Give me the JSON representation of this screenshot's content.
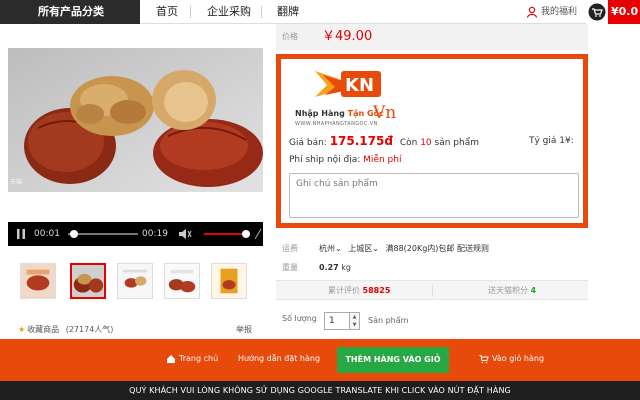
{
  "nav": {
    "category_btn": "所有产品分类",
    "items": [
      "首页",
      "企业采购",
      "翻牌"
    ],
    "favorites": "我的福利",
    "cart_price": "¥0.0"
  },
  "video": {
    "watermark": "天猫",
    "time_current": "00:01",
    "time_total": "00:19"
  },
  "left": {
    "collect": "收藏商品",
    "popularity": "(27174人气)",
    "report": "举报"
  },
  "price": {
    "label": "价格",
    "value": "￥49.00"
  },
  "widget": {
    "logo_brand": "Nhập Hàng",
    "logo_brand_accent": "Tận Gốc",
    "logo_vn": "Vn",
    "logo_url": "WWW.NHAPHANGTANGOC.VN",
    "price_label": "Giá bán:",
    "price_value": "175.175đ",
    "stock_prefix": "Còn",
    "stock_count": "10",
    "stock_suffix": "sản phẩm",
    "rate_label": "Tỷ giá 1¥:",
    "ship_label": "Phí ship nội địa:",
    "ship_value": "Miễn phí",
    "note_placeholder": "Ghi chú sản phẩm"
  },
  "details": {
    "ship_label": "运费",
    "ship_from": "杭州",
    "ship_to": "上城区",
    "ship_text": "满88(20Kg内)包邮 配送规则",
    "weight_label": "重量",
    "weight_value": "0.27",
    "weight_unit": "kg",
    "reviews_label": "累计评价",
    "reviews_count": "58825",
    "points_label": "送天猫积分",
    "points_count": "4",
    "qty_label": "Số lượng",
    "qty_value": "1",
    "qty_unit": "Sản phẩm"
  },
  "bottom": {
    "home": "Trang chủ",
    "guide": "Hướng dẫn đặt hàng",
    "add_to_cart": "THÊM HÀNG VÀO GIỎ",
    "view_cart": "Vào giỏ hàng",
    "warning": "QUÝ KHÁCH VUI LÒNG KHÔNG SỬ DỤNG GOOGLE TRANSLATE KHI CLICK VÀO NÚT ĐẶT HÀNG"
  },
  "colors": {
    "accent_orange": "#e84a0c",
    "price_red": "#e60000",
    "button_green": "#27a844"
  }
}
